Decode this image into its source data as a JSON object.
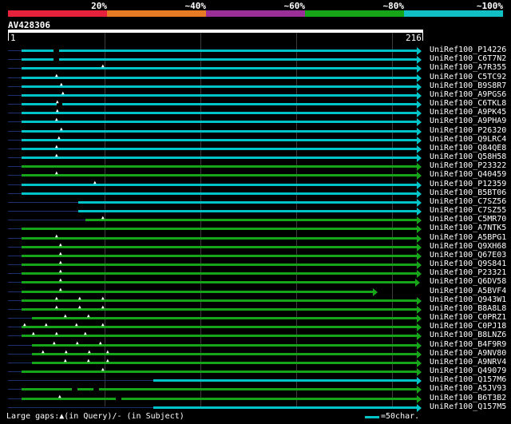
{
  "legend": {
    "labels": [
      "20%",
      "~40%",
      "~60%",
      "~80%",
      "~100%"
    ],
    "colors": [
      "#e6213c",
      "#e77a24",
      "#9a2f97",
      "#16a418",
      "#10c0c4"
    ]
  },
  "query": {
    "title": "AV428306",
    "start": "1",
    "end": "216"
  },
  "colors": {
    "cyan": "#00c4c8",
    "green": "#16a418",
    "dark": "#1c2f6e"
  },
  "hits": [
    {
      "label": "UniRef100_P14226",
      "color": "cyan",
      "start": 27,
      "end": 522,
      "pre": 10,
      "marks": [],
      "gaps": [
        67
      ]
    },
    {
      "label": "UniRef100_C6T7N2",
      "color": "cyan",
      "start": 27,
      "end": 522,
      "pre": 10,
      "marks": [],
      "gaps": [
        67
      ]
    },
    {
      "label": "UniRef100_A7R355",
      "color": "cyan",
      "start": 27,
      "end": 522,
      "pre": 10,
      "marks": [
        130
      ],
      "gaps": []
    },
    {
      "label": "UniRef100_C5TC92",
      "color": "cyan",
      "start": 27,
      "end": 522,
      "pre": 10,
      "marks": [
        72
      ],
      "gaps": []
    },
    {
      "label": "UniRef100_B9S8R7",
      "color": "cyan",
      "start": 27,
      "end": 522,
      "pre": 10,
      "marks": [
        78
      ],
      "gaps": []
    },
    {
      "label": "UniRef100_A9PGS6",
      "color": "cyan",
      "start": 27,
      "end": 522,
      "pre": 10,
      "marks": [
        80
      ],
      "gaps": []
    },
    {
      "label": "UniRef100_C6TKL8",
      "color": "cyan",
      "start": 27,
      "end": 522,
      "pre": 10,
      "marks": [
        73
      ],
      "gaps": [
        71
      ]
    },
    {
      "label": "UniRef100_A9PK45",
      "color": "cyan",
      "start": 27,
      "end": 522,
      "pre": 10,
      "marks": [
        73
      ],
      "gaps": []
    },
    {
      "label": "UniRef100_A9PHA9",
      "color": "cyan",
      "start": 27,
      "end": 522,
      "pre": 10,
      "marks": [
        72
      ],
      "gaps": []
    },
    {
      "label": "UniRef100_P26320",
      "color": "cyan",
      "start": 27,
      "end": 522,
      "pre": 10,
      "marks": [
        78
      ],
      "gaps": []
    },
    {
      "label": "UniRef100_Q9LRC4",
      "color": "cyan",
      "start": 27,
      "end": 522,
      "pre": 10,
      "marks": [
        75
      ],
      "gaps": []
    },
    {
      "label": "UniRef100_Q84QE8",
      "color": "cyan",
      "start": 27,
      "end": 522,
      "pre": 10,
      "marks": [
        72
      ],
      "gaps": []
    },
    {
      "label": "UniRef100_Q58H58",
      "color": "cyan",
      "start": 27,
      "end": 522,
      "pre": 10,
      "marks": [
        72
      ],
      "gaps": []
    },
    {
      "label": "UniRef100_P23322",
      "color": "green",
      "start": 27,
      "end": 522,
      "pre": 10,
      "marks": [],
      "gaps": []
    },
    {
      "label": "UniRef100_Q40459",
      "color": "green",
      "start": 27,
      "end": 522,
      "pre": 10,
      "marks": [
        72
      ],
      "gaps": []
    },
    {
      "label": "UniRef100_P12359",
      "color": "cyan",
      "start": 27,
      "end": 522,
      "pre": 10,
      "marks": [
        120
      ],
      "gaps": []
    },
    {
      "label": "UniRef100_B5BT06",
      "color": "cyan",
      "start": 27,
      "end": 522,
      "pre": 10,
      "marks": [],
      "gaps": []
    },
    {
      "label": "UniRef100_C7SZ56",
      "color": "cyan",
      "start": 98,
      "end": 522,
      "pre": 10,
      "marks": [],
      "gaps": []
    },
    {
      "label": "UniRef100_C7SZ55",
      "color": "cyan",
      "start": 98,
      "end": 522,
      "pre": 10,
      "marks": [],
      "gaps": []
    },
    {
      "label": "UniRef100_C5MR70",
      "color": "green",
      "start": 107,
      "end": 522,
      "pre": 10,
      "marks": [
        130
      ],
      "gaps": []
    },
    {
      "label": "UniRef100_A7NTK5",
      "color": "green",
      "start": 27,
      "end": 522,
      "pre": 10,
      "marks": [],
      "gaps": []
    },
    {
      "label": "UniRef100_A5BPG1",
      "color": "green",
      "start": 27,
      "end": 522,
      "pre": 10,
      "marks": [
        72
      ],
      "gaps": []
    },
    {
      "label": "UniRef100_Q9XH68",
      "color": "green",
      "start": 27,
      "end": 522,
      "pre": 10,
      "marks": [
        77
      ],
      "gaps": []
    },
    {
      "label": "UniRef100_Q67E03",
      "color": "green",
      "start": 27,
      "end": 522,
      "pre": 10,
      "marks": [
        77
      ],
      "gaps": []
    },
    {
      "label": "UniRef100_Q9S841",
      "color": "green",
      "start": 27,
      "end": 522,
      "pre": 10,
      "marks": [
        77
      ],
      "gaps": []
    },
    {
      "label": "UniRef100_P23321",
      "color": "green",
      "start": 27,
      "end": 522,
      "pre": 10,
      "marks": [
        77
      ],
      "gaps": []
    },
    {
      "label": "UniRef100_Q6DV58",
      "color": "green",
      "start": 27,
      "end": 520,
      "pre": 10,
      "marks": [
        77
      ],
      "gaps": []
    },
    {
      "label": "UniRef100_A5BVF4",
      "color": "green",
      "start": 27,
      "end": 467,
      "pre": 10,
      "marks": [
        77
      ],
      "gaps": []
    },
    {
      "label": "UniRef100_Q943W1",
      "color": "green",
      "start": 27,
      "end": 522,
      "pre": 10,
      "marks": [
        72,
        101,
        130
      ],
      "gaps": []
    },
    {
      "label": "UniRef100_B8A8L8",
      "color": "green",
      "start": 27,
      "end": 522,
      "pre": 10,
      "marks": [
        72,
        101,
        130
      ],
      "gaps": []
    },
    {
      "label": "UniRef100_C0PRZ1",
      "color": "green",
      "start": 40,
      "end": 522,
      "pre": 10,
      "marks": [
        83,
        112
      ],
      "gaps": []
    },
    {
      "label": "UniRef100_C0PJ18",
      "color": "green",
      "start": 27,
      "end": 522,
      "pre": 10,
      "marks": [
        32,
        59,
        97,
        130
      ],
      "gaps": []
    },
    {
      "label": "UniRef100_B8LNZ6",
      "color": "green",
      "start": 27,
      "end": 522,
      "pre": 10,
      "marks": [
        43,
        72,
        108
      ],
      "gaps": []
    },
    {
      "label": "UniRef100_B4F9R9",
      "color": "green",
      "start": 40,
      "end": 522,
      "pre": 10,
      "marks": [
        69,
        98,
        127
      ],
      "gaps": []
    },
    {
      "label": "UniRef100_A9NV80",
      "color": "green",
      "start": 40,
      "end": 522,
      "pre": 10,
      "marks": [
        55,
        84,
        113,
        136
      ],
      "gaps": []
    },
    {
      "label": "UniRef100_A9NRV4",
      "color": "green",
      "start": 40,
      "end": 522,
      "pre": 10,
      "marks": [
        83,
        112,
        136
      ],
      "gaps": []
    },
    {
      "label": "UniRef100_Q49079",
      "color": "green",
      "start": 27,
      "end": 522,
      "pre": 10,
      "marks": [
        130
      ],
      "gaps": []
    },
    {
      "label": "UniRef100_Q157M6",
      "color": "cyan",
      "start": 192,
      "end": 522,
      "pre": 10,
      "marks": [],
      "gaps": []
    },
    {
      "label": "UniRef100_A5JV93",
      "color": "green",
      "start": 27,
      "end": 522,
      "pre": 10,
      "marks": [],
      "gaps": [
        90,
        117
      ]
    },
    {
      "label": "UniRef100_B6T3B2",
      "color": "green",
      "start": 27,
      "end": 522,
      "pre": 10,
      "marks": [
        76
      ],
      "gaps": [
        145
      ]
    },
    {
      "label": "UniRef100_Q157M5",
      "color": "cyan",
      "start": 192,
      "end": 522,
      "pre": 10,
      "marks": [],
      "gaps": []
    }
  ],
  "footer": {
    "gap_text": "Large gaps:▲(in Query)/- (in Subject)",
    "scale_text": "=50char."
  }
}
